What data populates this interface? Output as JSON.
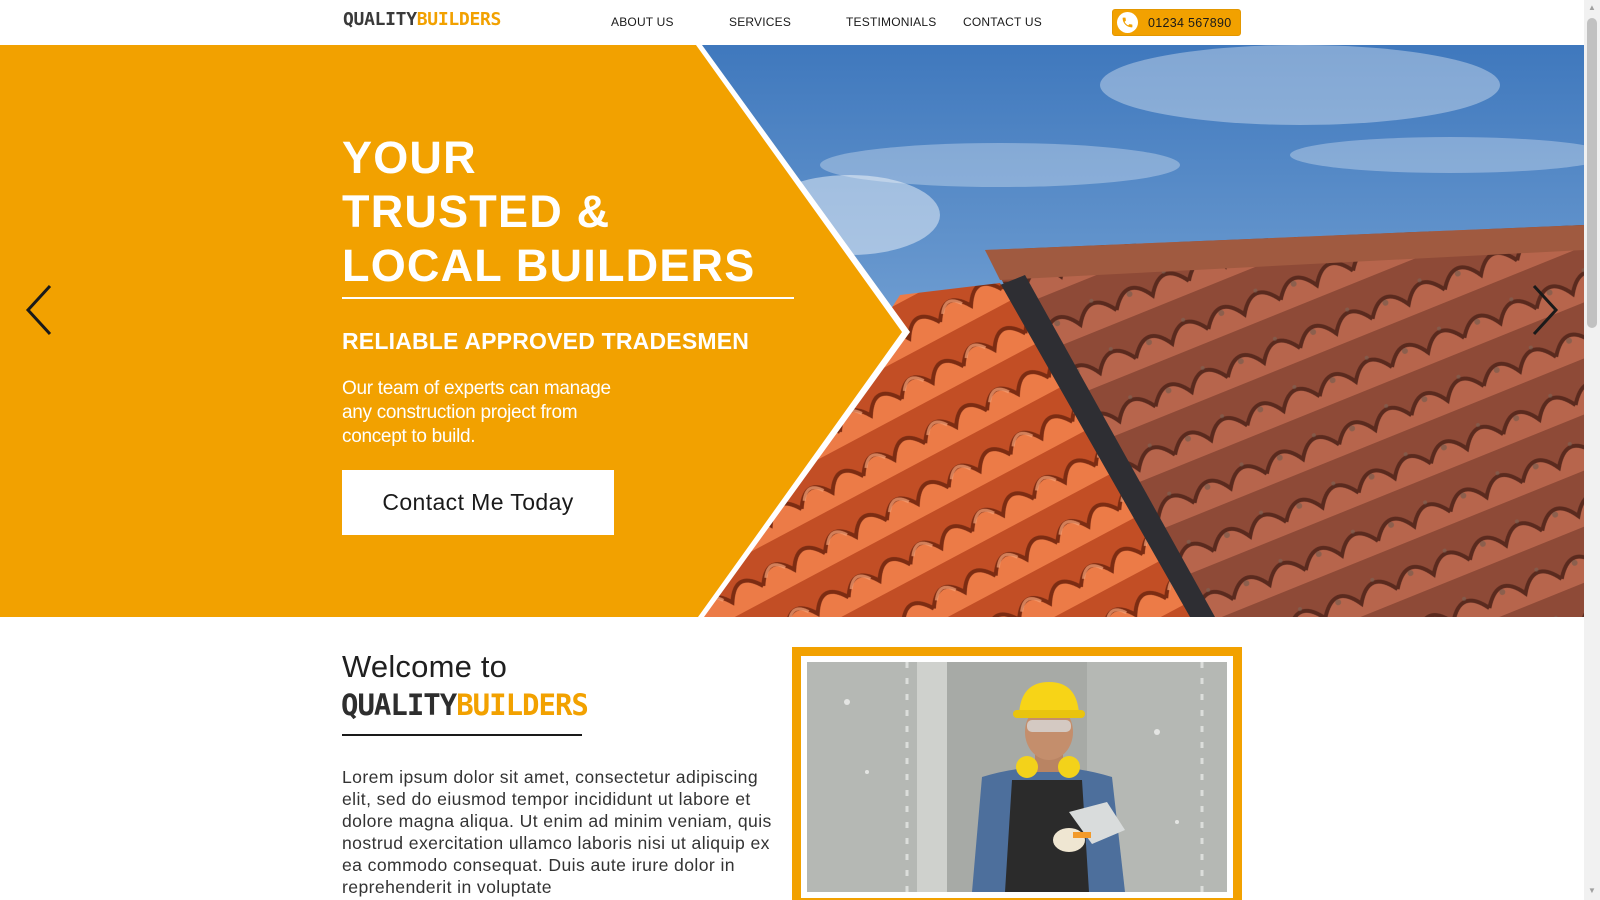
{
  "header": {
    "logo": {
      "part1": "QUALITY",
      "part2": "BUILDERS"
    },
    "nav": [
      {
        "label": "ABOUT US"
      },
      {
        "label": "SERVICES"
      },
      {
        "label": "TESTIMONIALS"
      },
      {
        "label": "CONTACT US"
      }
    ],
    "phone": "01234 567890"
  },
  "hero": {
    "title_lines": [
      "YOUR",
      "TRUSTED &",
      "LOCAL BUILDERS"
    ],
    "subtitle": "RELIABLE APPROVED TRADESMEN",
    "text": "Our team of experts can manage any construction project from concept to build.",
    "cta": "Contact Me Today"
  },
  "welcome": {
    "heading": "Welcome to",
    "brand": {
      "part1": "QUALITY",
      "part2": "BUILDERS"
    },
    "body": "Lorem ipsum dolor sit amet, consectetur adipiscing elit, sed do eiusmod tempor incididunt ut labore et dolore magna aliqua. Ut enim ad minim veniam, quis nostrud exercitation ullamco laboris nisi ut aliquip ex ea commodo consequat. Duis aute irure dolor in reprehenderit in voluptate"
  },
  "colors": {
    "brand": "#f2a100",
    "dark": "#1a1a1a",
    "white": "#ffffff"
  },
  "icons": [
    "phone-icon",
    "chevron-left-icon",
    "chevron-right-icon"
  ]
}
